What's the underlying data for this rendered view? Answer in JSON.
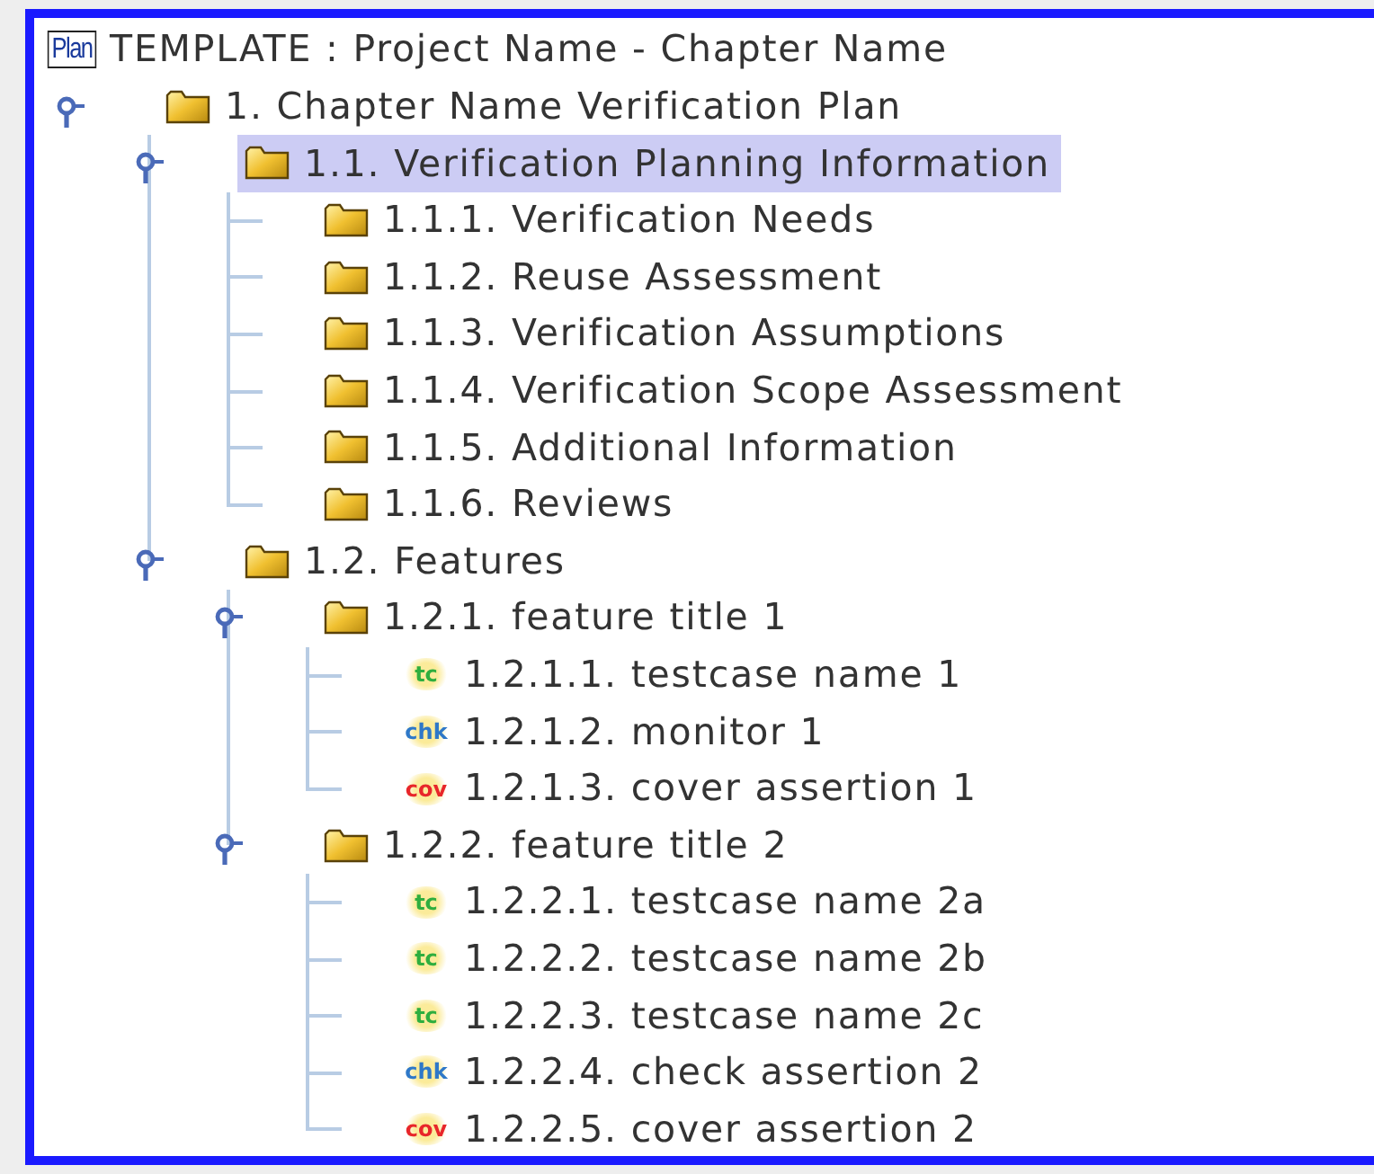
{
  "tree": {
    "icon_text": "Plan",
    "label": "TEMPLATE : Project Name - Chapter Name",
    "selected": false,
    "children": [
      {
        "kind": "folder",
        "label": "1. Chapter Name Verification Plan",
        "selected": false,
        "expanded": true,
        "children": [
          {
            "kind": "folder",
            "label": "1.1. Verification Planning Information",
            "selected": true,
            "expanded": true,
            "children": [
              {
                "kind": "folder",
                "label": "1.1.1. Verification Needs",
                "selected": false
              },
              {
                "kind": "folder",
                "label": "1.1.2. Reuse Assessment",
                "selected": false
              },
              {
                "kind": "folder",
                "label": "1.1.3. Verification Assumptions",
                "selected": false
              },
              {
                "kind": "folder",
                "label": "1.1.4. Verification Scope Assessment",
                "selected": false
              },
              {
                "kind": "folder",
                "label": "1.1.5. Additional Information",
                "selected": false
              },
              {
                "kind": "folder",
                "label": "1.1.6. Reviews",
                "selected": false
              }
            ]
          },
          {
            "kind": "folder",
            "label": "1.2. Features",
            "selected": false,
            "expanded": true,
            "children": [
              {
                "kind": "folder",
                "label": "1.2.1. feature title 1",
                "selected": false,
                "expanded": true,
                "children": [
                  {
                    "kind": "testcase",
                    "icon_text": "tc",
                    "label": "1.2.1.1. testcase name 1",
                    "selected": false
                  },
                  {
                    "kind": "check",
                    "icon_text": "chk",
                    "label": "1.2.1.2. monitor 1",
                    "selected": false
                  },
                  {
                    "kind": "cover",
                    "icon_text": "cov",
                    "label": "1.2.1.3. cover assertion 1",
                    "selected": false
                  }
                ]
              },
              {
                "kind": "folder",
                "label": "1.2.2. feature title 2",
                "selected": false,
                "expanded": true,
                "children": [
                  {
                    "kind": "testcase",
                    "icon_text": "tc",
                    "label": "1.2.2.1. testcase name 2a",
                    "selected": false
                  },
                  {
                    "kind": "testcase",
                    "icon_text": "tc",
                    "label": "1.2.2.2. testcase name 2b",
                    "selected": false
                  },
                  {
                    "kind": "testcase",
                    "icon_text": "tc",
                    "label": "1.2.2.3. testcase name 2c",
                    "selected": false
                  },
                  {
                    "kind": "check",
                    "icon_text": "chk",
                    "label": "1.2.2.4. check assertion 2",
                    "selected": false
                  },
                  {
                    "kind": "cover",
                    "icon_text": "cov",
                    "label": "1.2.2.5. cover assertion 2",
                    "selected": false
                  }
                ]
              }
            ]
          }
        ]
      }
    ]
  }
}
